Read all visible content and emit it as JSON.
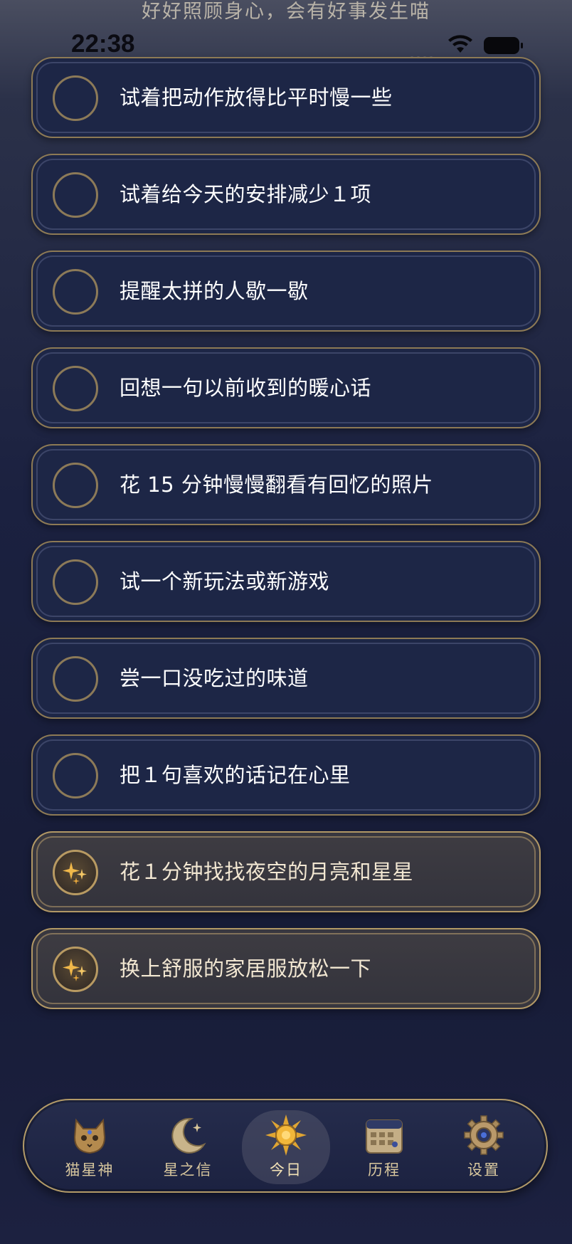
{
  "header": {
    "tip": "好好照顾身心，会有好事发生喵"
  },
  "status_bar": {
    "time": "22:38"
  },
  "tasks": [
    {
      "label": "试着把动作放得比平时慢一些",
      "done": false
    },
    {
      "label": "试着给今天的安排减少１项",
      "done": false
    },
    {
      "label": "提醒太拼的人歇一歇",
      "done": false
    },
    {
      "label": "回想一句以前收到的暖心话",
      "done": false
    },
    {
      "label": "花 15 分钟慢慢翻看有回忆的照片",
      "done": false
    },
    {
      "label": "试一个新玩法或新游戏",
      "done": false
    },
    {
      "label": "尝一口没吃过的味道",
      "done": false
    },
    {
      "label": "把１句喜欢的话记在心里",
      "done": false
    },
    {
      "label": "花１分钟找找夜空的月亮和星星",
      "done": true
    },
    {
      "label": "换上舒服的家居服放松一下",
      "done": true
    }
  ],
  "tab_bar": {
    "active": "今日",
    "tabs": [
      {
        "label": "猫星神",
        "icon": "cat-icon"
      },
      {
        "label": "星之信",
        "icon": "moon-icon"
      },
      {
        "label": "今日",
        "icon": "sun-icon"
      },
      {
        "label": "历程",
        "icon": "calendar-icon"
      },
      {
        "label": "设置",
        "icon": "gear-icon"
      }
    ]
  },
  "colors": {
    "accent_gold": "#b39b68",
    "card_bg": "#1d2646",
    "done_card_bg": "#3a3940"
  }
}
